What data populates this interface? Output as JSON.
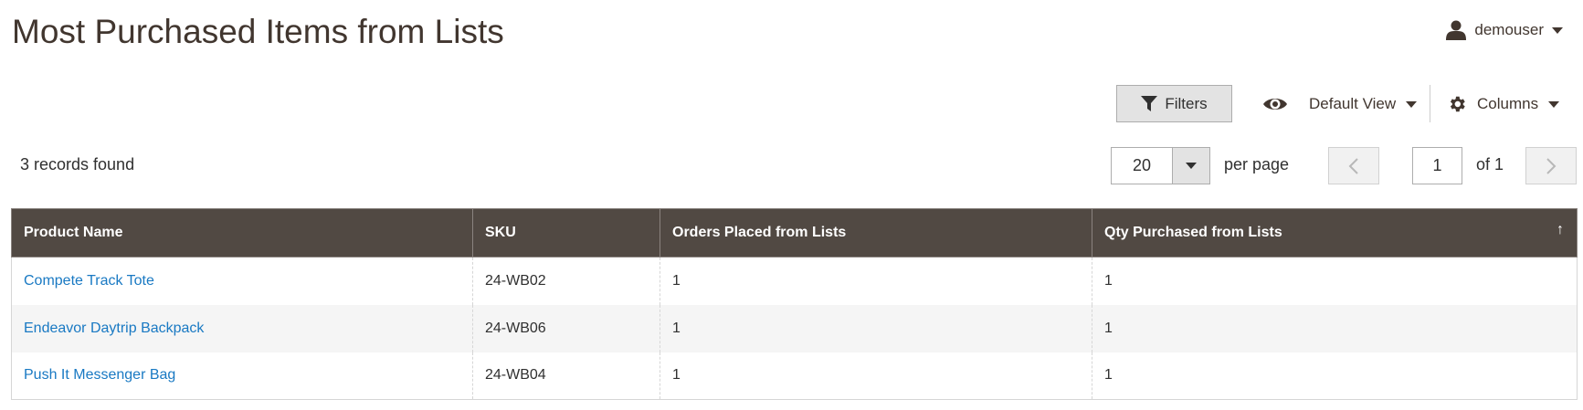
{
  "header": {
    "title": "Most Purchased Items from Lists",
    "user": {
      "name": "demouser",
      "icon": "user-icon"
    }
  },
  "toolbar": {
    "filters_label": "Filters",
    "view_label": "Default View",
    "columns_label": "Columns"
  },
  "pager": {
    "records_text": "3 records found",
    "per_page_value": "20",
    "per_page_label": "per page",
    "current_page": "1",
    "of_total": "of 1"
  },
  "table": {
    "columns": [
      "Product Name",
      "SKU",
      "Orders Placed from Lists",
      "Qty Purchased from Lists"
    ],
    "sort_indicator": "↑",
    "rows": [
      {
        "name": "Compete Track Tote",
        "sku": "24-WB02",
        "orders": "1",
        "qty": "1"
      },
      {
        "name": "Endeavor Daytrip Backpack",
        "sku": "24-WB06",
        "orders": "1",
        "qty": "1"
      },
      {
        "name": "Push It Messenger Bag",
        "sku": "24-WB04",
        "orders": "1",
        "qty": "1"
      }
    ]
  },
  "colors": {
    "header_bg": "#514943",
    "link": "#1979c3",
    "title": "#41362f"
  }
}
